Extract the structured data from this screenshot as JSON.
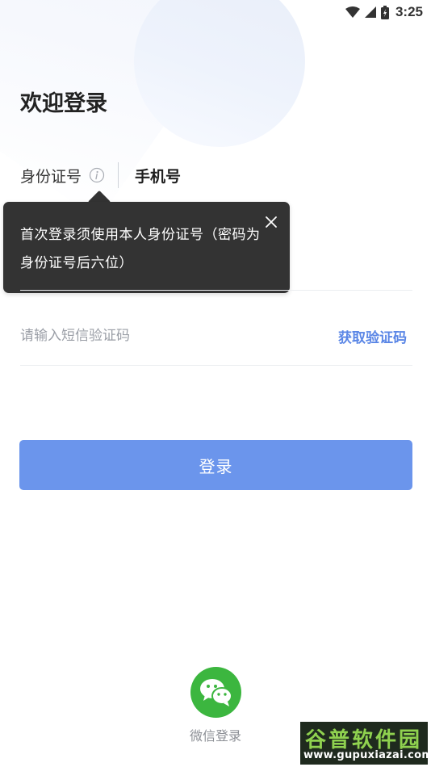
{
  "status_bar": {
    "time": "3:25",
    "icons": [
      "wifi-icon",
      "cell-signal-icon",
      "battery-icon"
    ]
  },
  "title": "欢迎登录",
  "tabs": {
    "id_card": "身份证号",
    "phone": "手机号",
    "info_icon": "info-icon"
  },
  "tooltip": {
    "text": "首次登录须使用本人身份证号（密码为身份证号后六位）",
    "close_icon": "close-icon"
  },
  "sms": {
    "placeholder": "请输入短信验证码",
    "value": "",
    "get_code_label": "获取验证码"
  },
  "login_button": "登录",
  "wechat": {
    "label": "微信登录",
    "icon": "wechat-icon"
  },
  "watermark": {
    "name": "谷普软件园",
    "url": "www.gupuxiazai.com"
  },
  "colors": {
    "accent": "#6b95ec",
    "link": "#5a86e6",
    "tooltip_bg": "#333333",
    "wechat_green": "#3cb63f"
  }
}
